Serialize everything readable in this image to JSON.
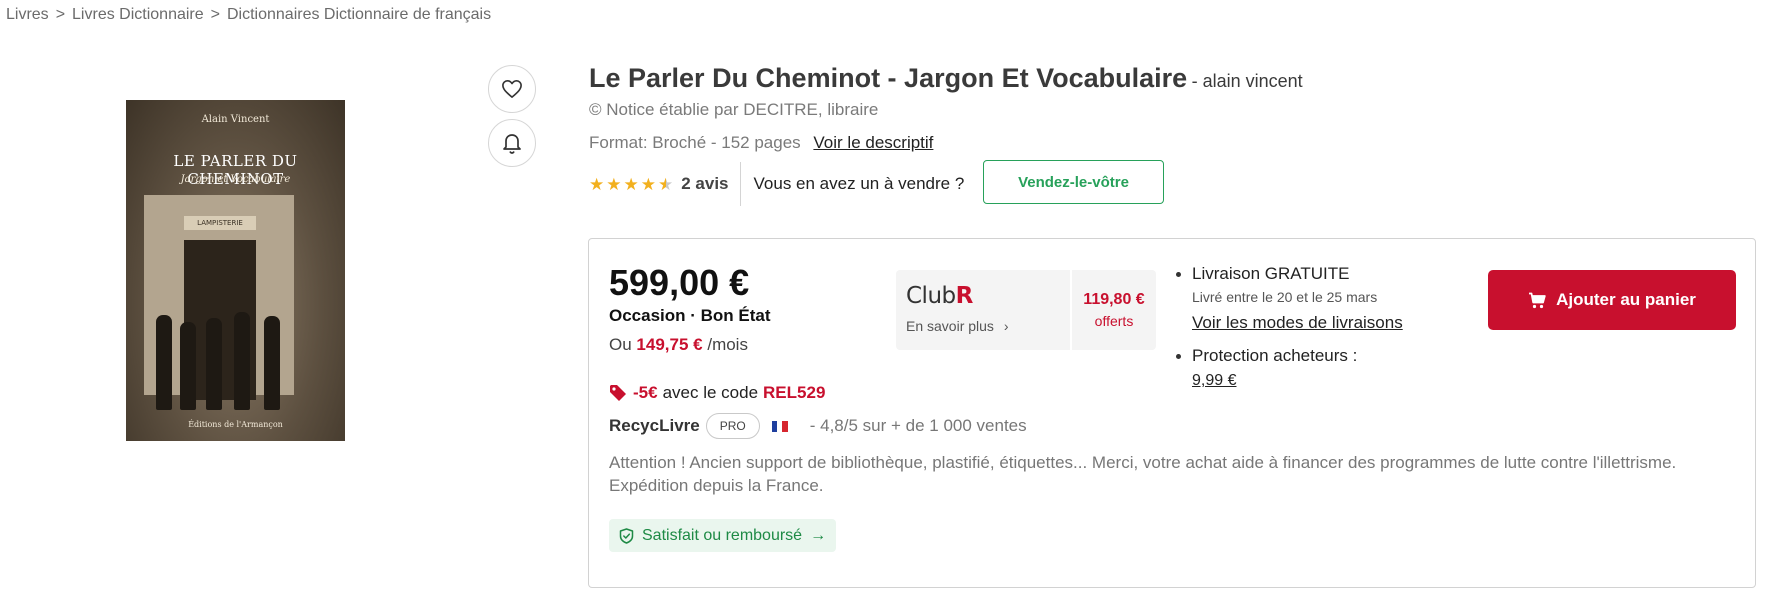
{
  "breadcrumb": {
    "items": [
      "Livres",
      "Livres Dictionnaire",
      "Dictionnaires Dictionnaire de français"
    ],
    "separator": ">"
  },
  "cover": {
    "author": "Alain Vincent",
    "title": "LE PARLER DU CHEMINOT",
    "subtitle": "Jargon et Vocabulaire",
    "sign": "LAMPISTERIE",
    "publisher": "Éditions de l'Armançon"
  },
  "actions": {
    "favorite_icon": "heart-icon",
    "alert_icon": "bell-icon"
  },
  "product": {
    "title": "Le Parler Du Cheminot - Jargon Et Vocabulaire",
    "author": "- alain vincent",
    "notice": "© Notice établie par DECITRE, libraire",
    "format": "Format: Broché - 152 pages",
    "descriptif_link": "Voir le descriptif",
    "rating_stars": 4.5,
    "reviews": "2 avis",
    "sell_question": "Vous en avez un à vendre ?",
    "sell_button": "Vendez-le-vôtre"
  },
  "offer": {
    "price": "599,00 €",
    "condition": "Occasion · Bon État",
    "monthly_prefix": "Ou",
    "monthly_amount": "149,75 €",
    "monthly_suffix": "/mois",
    "club": {
      "logo_text": "Club",
      "logo_letter": "R",
      "learn_more": "En savoir plus",
      "offered_amount": "119,80 €",
      "offered_label": "offerts"
    },
    "shipping": {
      "free": "Livraison GRATUITE",
      "delivery_dates": "Livré entre le 20 et le 25 mars",
      "modes_link": "Voir les modes de livraisons",
      "protection": "Protection acheteurs :",
      "protection_price": "9,99 €"
    },
    "add_to_cart": "Ajouter au panier",
    "promo": {
      "discount": "-5€",
      "text": "avec le code",
      "code": "REL529"
    },
    "seller": {
      "name": "RecycLivre",
      "badge": "PRO",
      "stats": "- 4,8/5 sur + de 1 000 ventes"
    },
    "description": "Attention ! Ancien support de bibliothèque, plastifié, étiquettes... Merci, votre achat aide à financer des programmes de lutte contre l'illettrisme. Expédition depuis la France.",
    "guarantee": "Satisfait ou remboursé"
  },
  "colors": {
    "accent_red": "#c8102e",
    "green": "#27a15a",
    "star": "#f2b01e"
  }
}
